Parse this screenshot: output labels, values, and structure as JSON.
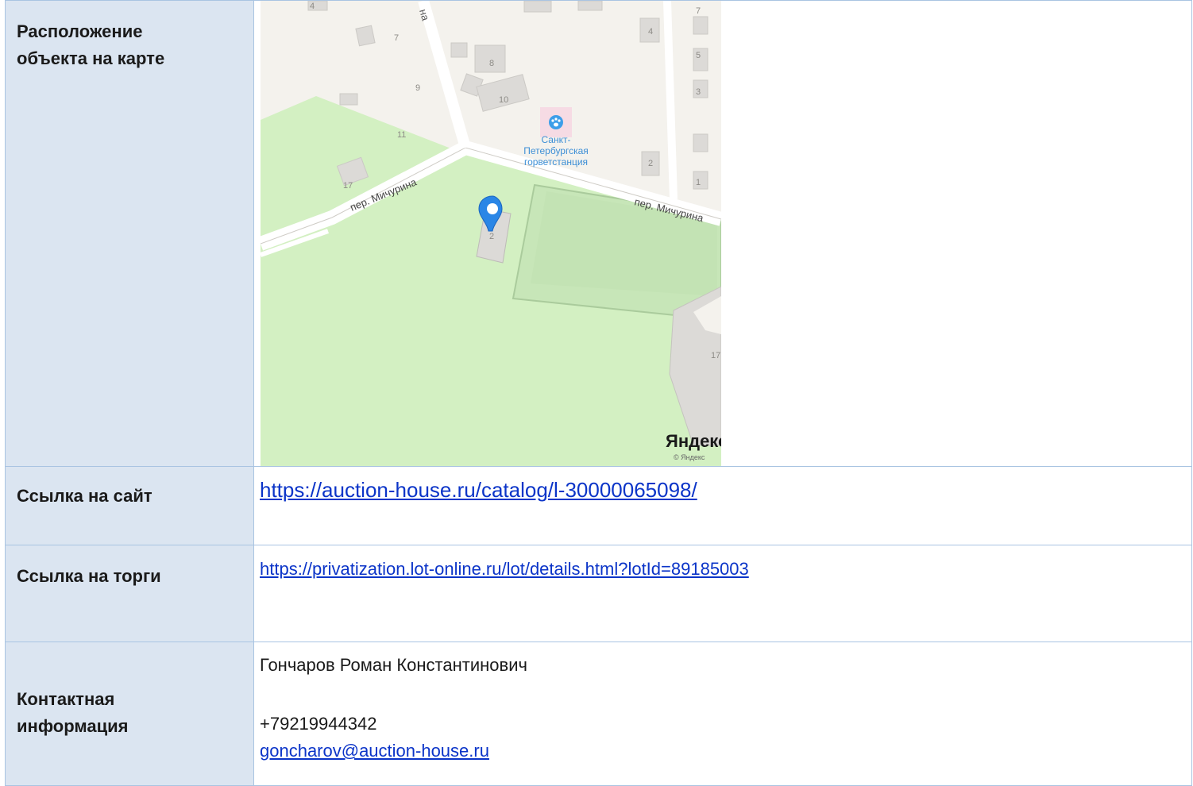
{
  "rows": {
    "map": {
      "label_line1": "Расположение",
      "label_line2": "объекта на карте"
    },
    "site": {
      "label": "Ссылка на сайт",
      "url": "https://auction-house.ru/catalog/l-30000065098/"
    },
    "torgi": {
      "label": "Ссылка на торги",
      "url": "https://privatization.lot-online.ru/lot/details.html?lotId=89185003"
    },
    "contact": {
      "label_line1": "Контактная",
      "label_line2": "информация",
      "name": "Гончаров Роман Константинович",
      "phone": "+79219944342",
      "email": "goncharov@auction-house.ru"
    }
  },
  "map": {
    "street_left": "пер. Мичурина",
    "street_right": "пер. Мичурина",
    "street_vertical": "на",
    "poi_line1": "Санкт-",
    "poi_line2": "Петербургская",
    "poi_line3": "горветстанция",
    "marker_building_number": "2",
    "house_numbers": [
      "4",
      "7",
      "8",
      "9",
      "10",
      "11",
      "17",
      "4",
      "5",
      "3",
      "2",
      "1",
      "7",
      "17"
    ],
    "brand_logo": "Яндекс",
    "copyright": "© Яндекс",
    "colors": {
      "park": "#d3f0c2",
      "field": "#c8e8b9",
      "urban": "#f4f2ed",
      "building": "#dcdad7",
      "road": "#ffffff",
      "pin": "#2a86e6",
      "poi": "#3d9ee9"
    }
  }
}
